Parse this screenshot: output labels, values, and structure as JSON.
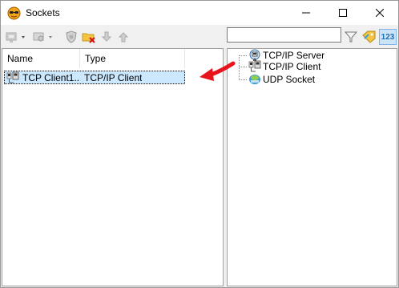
{
  "window": {
    "title": "Sockets",
    "icon": "sockets-app-icon"
  },
  "toolbar": {
    "buttons": [
      {
        "name": "new-socket-dropdown-button",
        "icon": "socket-add-icon"
      },
      {
        "name": "socket-options-dropdown-button",
        "icon": "socket-gear-icon"
      },
      {
        "name": "shield-button",
        "icon": "shield-icon"
      },
      {
        "name": "delete-button",
        "icon": "folder-delete-icon"
      },
      {
        "name": "move-down-button",
        "icon": "arrow-down-icon"
      },
      {
        "name": "move-up-button",
        "icon": "arrow-up-icon"
      }
    ],
    "search": {
      "value": "",
      "placeholder": ""
    },
    "right_buttons": [
      {
        "name": "filter-button",
        "icon": "funnel-icon"
      },
      {
        "name": "tag-button",
        "icon": "tag-icon"
      },
      {
        "name": "numbers-button",
        "icon": "123-icon",
        "label": "123"
      }
    ]
  },
  "list": {
    "columns": [
      "Name",
      "Type"
    ],
    "rows": [
      {
        "name": "TCP Client1...",
        "type": "TCP/IP Client",
        "icon": "tcp-client-icon",
        "selected": true
      }
    ]
  },
  "tree": {
    "items": [
      {
        "label": "TCP/IP Server",
        "icon": "tcp-server-icon"
      },
      {
        "label": "TCP/IP Client",
        "icon": "tcp-client-icon"
      },
      {
        "label": "UDP Socket",
        "icon": "udp-socket-icon"
      }
    ]
  },
  "colors": {
    "selection": "#cce8ff",
    "arrow": "#e8141c"
  }
}
